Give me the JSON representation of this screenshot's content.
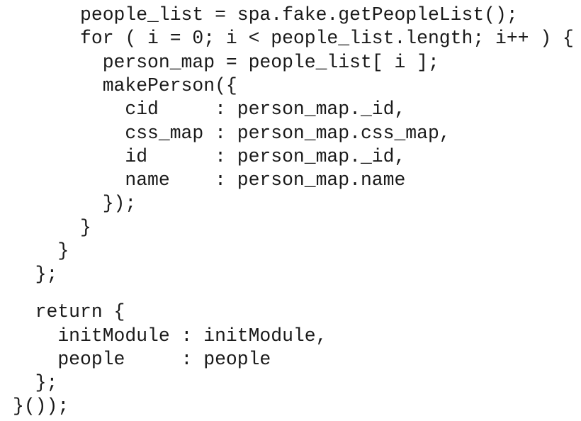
{
  "code": {
    "lines": [
      "      people_list = spa.fake.getPeopleList();",
      "      for ( i = 0; i < people_list.length; i++ ) {",
      "        person_map = people_list[ i ];",
      "        makePerson({",
      "          cid     : person_map._id,",
      "          css_map : person_map.css_map,",
      "          id      : person_map._id,",
      "          name    : person_map.name",
      "        });",
      "      }",
      "    }",
      "  };",
      "  return {",
      "    initModule : initModule,",
      "    people     : people",
      "  };",
      "}());"
    ]
  }
}
